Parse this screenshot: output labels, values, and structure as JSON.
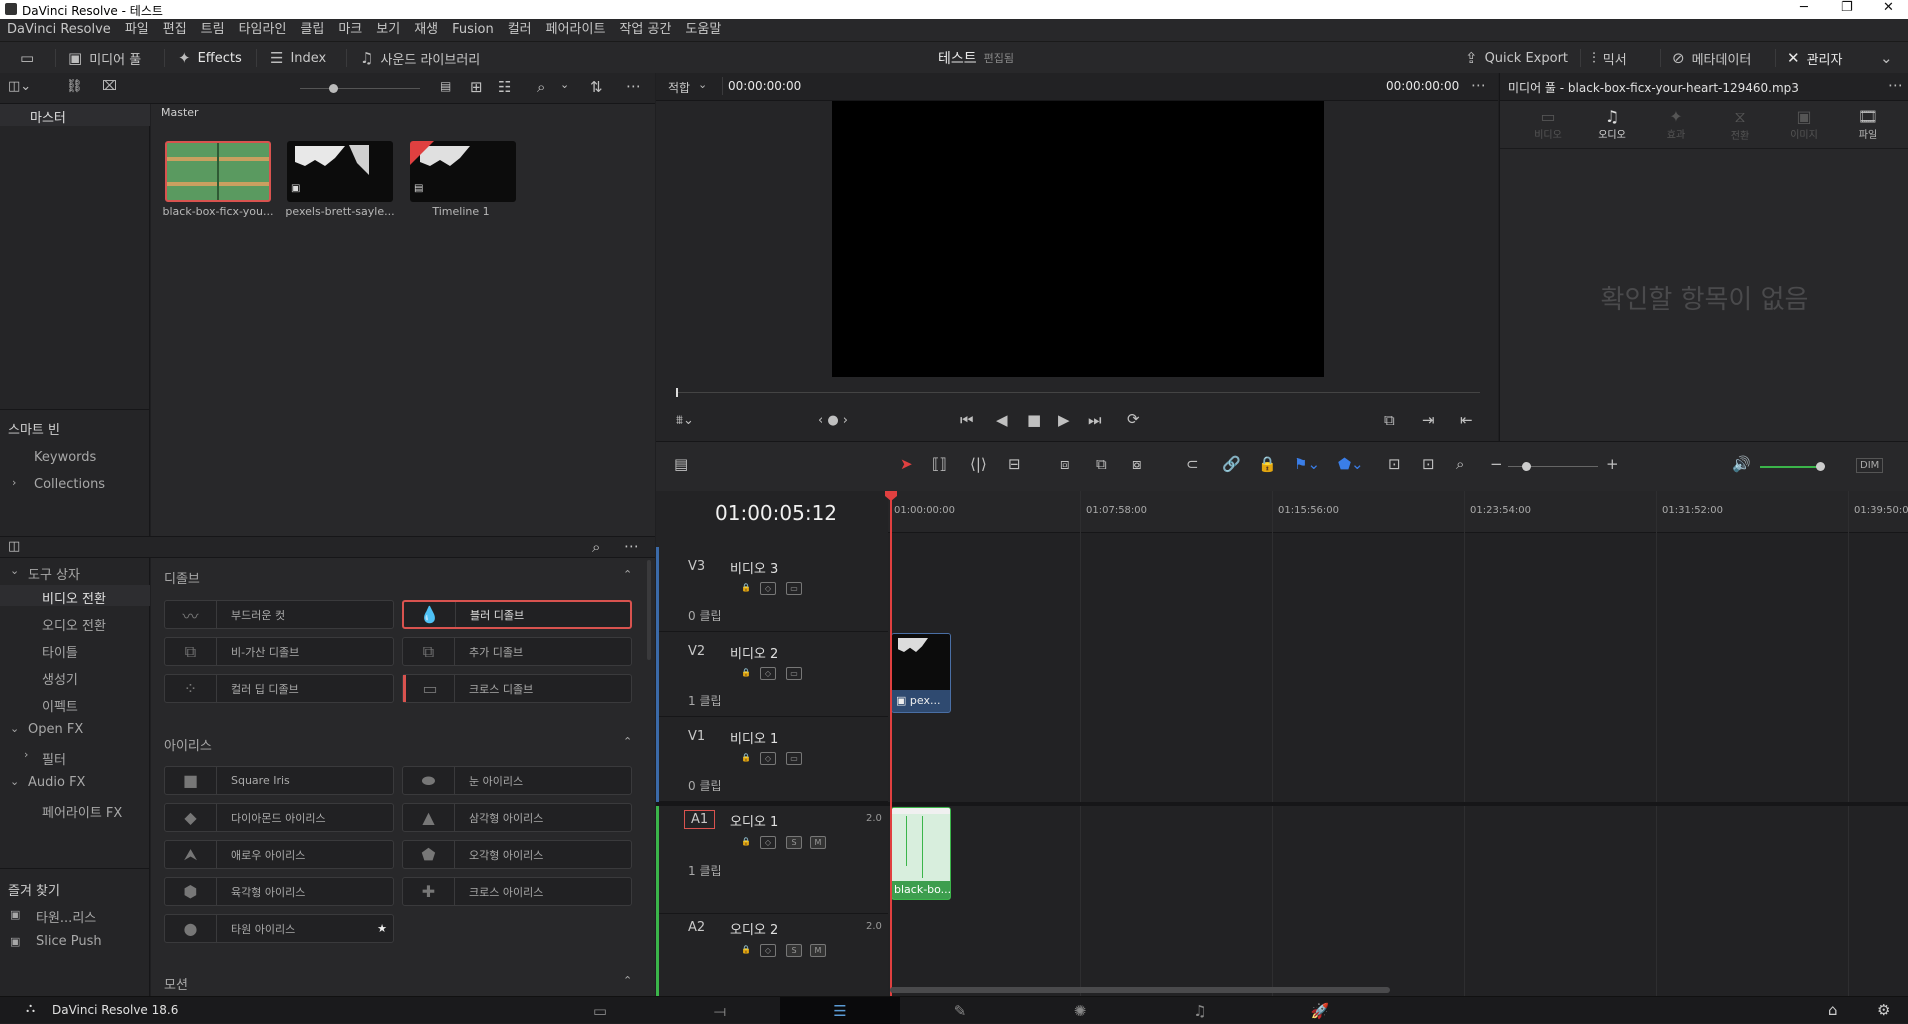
{
  "window": {
    "title": "DaVinci Resolve - 테스트",
    "minimize": "─",
    "restore": "❐",
    "close": "✕"
  },
  "menu": [
    "DaVinci Resolve",
    "파일",
    "편집",
    "트림",
    "타임라인",
    "클립",
    "마크",
    "보기",
    "재생",
    "Fusion",
    "컬러",
    "페어라이트",
    "작업 공간",
    "도움말"
  ],
  "toolbar": {
    "media_pool": "미디어 풀",
    "effects": "Effects",
    "index": "Index",
    "sound_library": "사운드 라이브러리",
    "project_name": "테스트",
    "edited": "편집됨",
    "quick_export": "Quick Export",
    "mixer": "믹서",
    "metadata": "메타데이터",
    "inspector": "관리자"
  },
  "bins": {
    "master_bin": "마스터",
    "master_header": "Master",
    "smart_bins": "스마트 빈",
    "keywords": "Keywords",
    "collections": "Collections"
  },
  "clips": [
    {
      "name": "black-box-ficx-you..."
    },
    {
      "name": "pexels-brett-sayle..."
    },
    {
      "name": "Timeline 1"
    }
  ],
  "fx_tree": {
    "toolbox": "도구 상자",
    "video_transitions": "비디오 전환",
    "audio_transitions": "오디오 전환",
    "titles": "타이틀",
    "generators": "생성기",
    "effects": "이펙트",
    "open_fx": "Open FX",
    "filters": "필터",
    "audio_fx": "Audio FX",
    "fairlight_fx": "페어라이트 FX",
    "favorites": "즐겨 찾기",
    "fav1": "타원...리스",
    "fav2": "Slice Push"
  },
  "fx_sections": {
    "dissolve": "디졸브",
    "iris": "아이리스",
    "motion": "모션"
  },
  "dissolves": [
    "부드러운 컷",
    "블러 디졸브",
    "비-가산 디졸브",
    "추가 디졸브",
    "컬러 딥 디졸브",
    "크로스 디졸브"
  ],
  "irises": [
    "Square Iris",
    "눈 아이리스",
    "다이아몬드 아이리스",
    "삼각형 아이리스",
    "애로우 아이리스",
    "오각형 아이리스",
    "육각형 아이리스",
    "크로스 아이리스",
    "타원 아이리스"
  ],
  "viewer": {
    "fit": "적합",
    "timecode_left": "00:00:00:00",
    "timecode_right": "00:00:00:00"
  },
  "inspector": {
    "title": "미디어 풀 - black-box-ficx-your-heart-129460.mp3",
    "tabs": [
      "비디오",
      "오디오",
      "효과",
      "전환",
      "이미지",
      "파일"
    ],
    "empty": "확인할 항목이 없음"
  },
  "timeline": {
    "timecode": "01:00:05:12",
    "ruler": [
      "01:00:00:00",
      "01:07:58:00",
      "01:15:56:00",
      "01:23:54:00",
      "01:31:52:00",
      "01:39:50:00"
    ],
    "dim": "DIM"
  },
  "tracks": [
    {
      "id": "V3",
      "name": "비디오 3",
      "count": "0 클립"
    },
    {
      "id": "V2",
      "name": "비디오 2",
      "count": "1 클립"
    },
    {
      "id": "V1",
      "name": "비디오 1",
      "count": "0 클립"
    },
    {
      "id": "A1",
      "name": "오디오 1",
      "count": "1 클립",
      "ch": "2.0"
    },
    {
      "id": "A2",
      "name": "오디오 2",
      "count": "",
      "ch": "2.0"
    }
  ],
  "clip_labels": {
    "video": "pex...",
    "audio": "black-bo..."
  },
  "status": {
    "app": "DaVinci Resolve 18.6"
  }
}
